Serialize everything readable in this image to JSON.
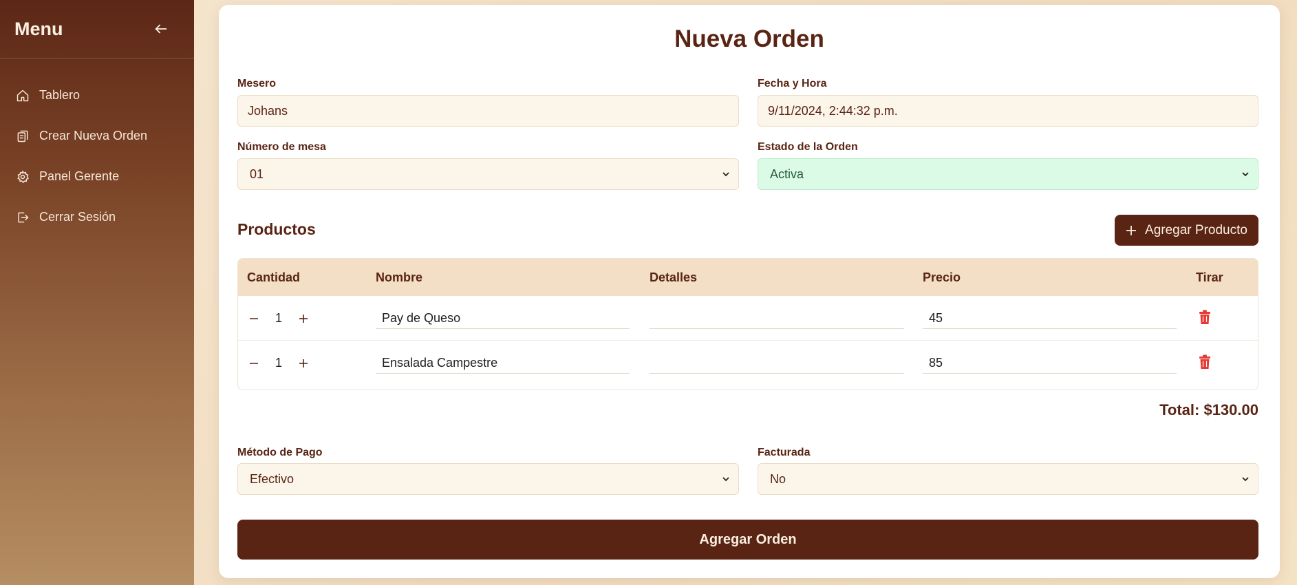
{
  "sidebar": {
    "title": "Menu",
    "items": [
      {
        "label": "Tablero",
        "icon": "home-icon"
      },
      {
        "label": "Crear Nueva Orden",
        "icon": "clipboard-icon"
      },
      {
        "label": "Panel Gerente",
        "icon": "gear-icon"
      },
      {
        "label": "Cerrar Sesión",
        "icon": "logout-icon"
      }
    ]
  },
  "form": {
    "title": "Nueva Orden",
    "waiter": {
      "label": "Mesero",
      "value": "Johans"
    },
    "datetime": {
      "label": "Fecha y Hora",
      "value": "9/11/2024, 2:44:32 p.m."
    },
    "table_number": {
      "label": "Número de mesa",
      "value": "01"
    },
    "status": {
      "label": "Estado de la Orden",
      "value": "Activa"
    }
  },
  "products": {
    "title": "Productos",
    "add_label": "Agregar Producto",
    "columns": [
      "Cantidad",
      "Nombre",
      "Detalles",
      "Precio",
      "Tirar"
    ],
    "rows": [
      {
        "quantity": "1",
        "name": "Pay de Queso",
        "details": "",
        "price": "45"
      },
      {
        "quantity": "1",
        "name": "Ensalada Campestre",
        "details": "",
        "price": "85"
      }
    ],
    "total": "Total: $130.00"
  },
  "payment": {
    "method": {
      "label": "Método de Pago",
      "value": "Efectivo"
    },
    "invoiced": {
      "label": "Facturada",
      "value": "No"
    }
  },
  "submit_label": "Agregar Orden",
  "colors": {
    "primary": "#5a2414",
    "field_bg": "#fcf6ea",
    "status_bg": "#dcfbe6",
    "delete": "#e53935"
  }
}
